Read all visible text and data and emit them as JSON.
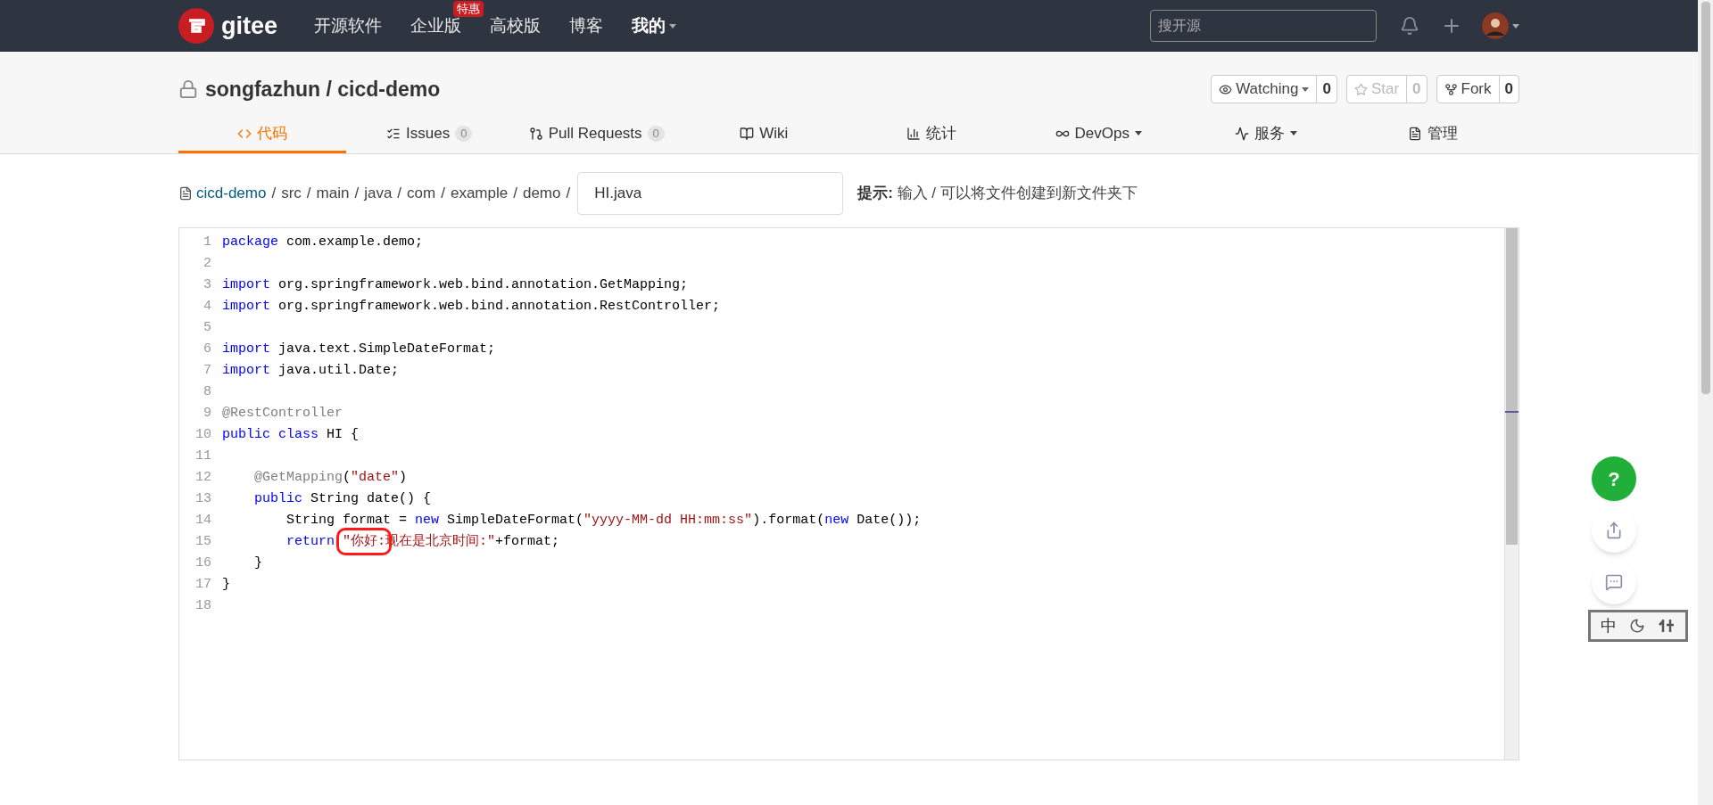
{
  "navbar": {
    "logo": "gitee",
    "links": [
      {
        "label": "开源软件"
      },
      {
        "label": "企业版",
        "badge": "特惠"
      },
      {
        "label": "高校版"
      },
      {
        "label": "博客"
      },
      {
        "label": "我的",
        "menu": true
      }
    ],
    "search": {
      "placeholder": "搜开源"
    }
  },
  "repo": {
    "title": "songfazhun / cicd-demo",
    "actions": [
      {
        "label": "Watching",
        "count": "0",
        "menu": true,
        "disabled": false
      },
      {
        "label": "Star",
        "count": "0",
        "menu": false,
        "disabled": true
      },
      {
        "label": "Fork",
        "count": "0",
        "menu": false,
        "disabled": false
      }
    ]
  },
  "tabs": [
    {
      "label": "代码",
      "selected": true
    },
    {
      "label": "Issues",
      "count": "0",
      "selected": false
    },
    {
      "label": "Pull Requests",
      "count": "0",
      "selected": false
    },
    {
      "label": "Wiki",
      "selected": false
    },
    {
      "label": "统计",
      "selected": false
    },
    {
      "label": "DevOps",
      "menu": true,
      "selected": false
    },
    {
      "label": "服务",
      "menu": true,
      "selected": false
    },
    {
      "label": "管理",
      "selected": false
    }
  ],
  "breadcrumb": {
    "path": [
      {
        "label": "cicd-demo",
        "link": true,
        "separator": "/"
      },
      {
        "label": "src",
        "link": false,
        "separator": "/"
      },
      {
        "label": "main",
        "link": false,
        "separator": "/"
      },
      {
        "label": "java",
        "link": false,
        "separator": "/"
      },
      {
        "label": "com",
        "link": false,
        "separator": "/"
      },
      {
        "label": "example",
        "link": false,
        "separator": "/"
      },
      {
        "label": "demo",
        "link": false,
        "separator": "/"
      }
    ],
    "filename": "HI.java",
    "hint": "**提示:** 输入 / 可以将文件创建到新文件夹下"
  },
  "editor": {
    "lines": [
      {
        "number": "1",
        "tokens": [
          {
            "kind": "kw",
            "text": "package"
          },
          {
            "kind": "plain",
            "text": " com.example.demo;"
          }
        ]
      },
      {
        "number": "2"
      },
      {
        "number": "3",
        "tokens": [
          {
            "kind": "kw",
            "text": "import"
          },
          {
            "kind": "plain",
            "text": " org.springframework.web.bind.annotation.GetMapping;"
          }
        ]
      },
      {
        "number": "4",
        "tokens": [
          {
            "kind": "kw",
            "text": "import"
          },
          {
            "kind": "plain",
            "text": " org.springframework.web.bind.annotation.RestController;"
          }
        ]
      },
      {
        "number": "5"
      },
      {
        "number": "6",
        "tokens": [
          {
            "kind": "kw",
            "text": "import"
          },
          {
            "kind": "plain",
            "text": " java.text.SimpleDateFormat;"
          }
        ]
      },
      {
        "number": "7",
        "tokens": [
          {
            "kind": "kw",
            "text": "import"
          },
          {
            "kind": "plain",
            "text": " java.util.Date;"
          }
        ]
      },
      {
        "number": "8"
      },
      {
        "number": "9",
        "tokens": [
          {
            "kind": "ann",
            "text": "@RestController"
          }
        ]
      },
      {
        "number": "10",
        "tokens": [
          {
            "kind": "kw",
            "text": "public class"
          },
          {
            "kind": "plain",
            "text": " HI {"
          }
        ]
      },
      {
        "number": "11"
      },
      {
        "number": "12",
        "tokens": [
          {
            "kind": "ann",
            "text": "    @GetMapping"
          },
          {
            "kind": "plain",
            "text": "("
          },
          {
            "kind": "str",
            "text": "\"date\""
          },
          {
            "kind": "plain",
            "text": ")"
          }
        ]
      },
      {
        "number": "13",
        "tokens": [
          {
            "kind": "kw",
            "text": "    public"
          },
          {
            "kind": "plain",
            "text": " String date() {"
          }
        ]
      },
      {
        "number": "14",
        "tokens": [
          {
            "kind": "plain",
            "text": "        String format = "
          },
          {
            "kind": "kw",
            "text": "new"
          },
          {
            "kind": "plain",
            "text": " SimpleDateFormat("
          },
          {
            "kind": "str",
            "text": "\"yyyy-MM-dd HH:mm:ss\""
          },
          {
            "kind": "plain",
            "text": ").format("
          },
          {
            "kind": "kw",
            "text": "new"
          },
          {
            "kind": "plain",
            "text": " Date());"
          }
        ]
      },
      {
        "number": "15",
        "tokens": [
          {
            "kind": "kw",
            "text": "        return "
          },
          {
            "kind": "str",
            "text": "\"你好:",
            "boxed": true
          },
          {
            "kind": "str",
            "text": "现在是北京时间:\""
          },
          {
            "kind": "plain",
            "text": "+format;"
          }
        ]
      },
      {
        "number": "16",
        "tokens": [
          {
            "kind": "plain",
            "text": "    }"
          }
        ]
      },
      {
        "number": "17",
        "tokens": [
          {
            "kind": "plain",
            "text": "}"
          }
        ]
      },
      {
        "number": "18"
      }
    ]
  },
  "floating": {
    "help": "?"
  },
  "ime": {
    "mode": "中"
  }
}
